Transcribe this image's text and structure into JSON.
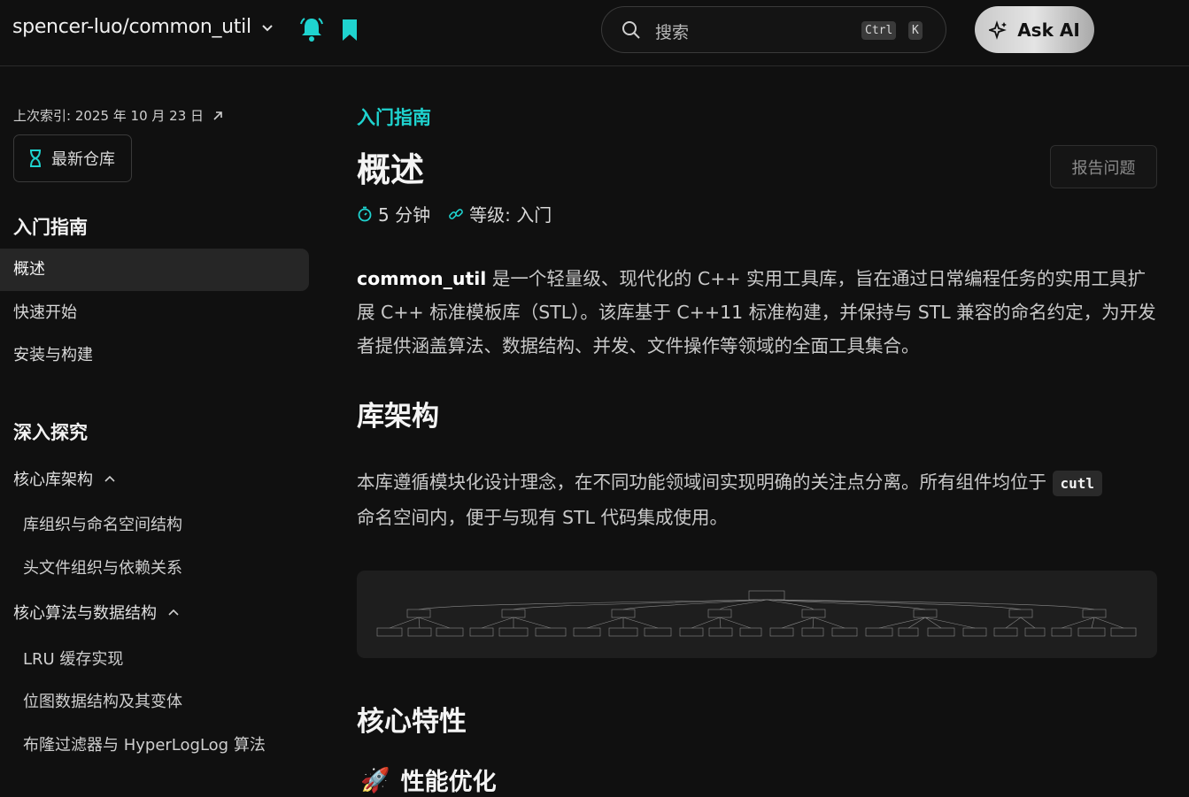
{
  "header": {
    "repo_name": "spencer-luo/common_util",
    "search_placeholder": "搜索",
    "kbd_ctrl": "Ctrl",
    "kbd_k": "K",
    "ask_ai": "Ask AI"
  },
  "sidebar": {
    "last_indexed": "上次索引: 2025 年 10 月 23 日",
    "latest_repo": "最新仓库",
    "section1_title": "入门指南",
    "section1_items": [
      "概述",
      "快速开始",
      "安装与构建"
    ],
    "section2_title": "深入探究",
    "group1": "核心库架构",
    "group1_items": [
      "库组织与命名空间结构",
      "头文件组织与依赖关系"
    ],
    "group2": "核心算法与数据结构",
    "group2_items": [
      "LRU 缓存实现",
      "位图数据结构及其变体",
      "布隆过滤器与 HyperLogLog 算法"
    ]
  },
  "main": {
    "breadcrumb": "入门指南",
    "title": "概述",
    "report_button": "报告问题",
    "read_time": "5 分钟",
    "level": "等级: 入门",
    "intro_bold": "common_util",
    "intro_rest": " 是一个轻量级、现代化的 C++ 实用工具库，旨在通过日常编程任务的实用工具扩展 C++ 标准模板库（STL）。该库基于 C++11 标准构建，并保持与 STL 兼容的命名约定，为开发者提供涵盖算法、数据结构、并发、文件操作等领域的全面工具集合。",
    "h2_arch": "库架构",
    "arch_text_before": "本库遵循模块化设计理念，在不同功能领域间实现明确的关注点分离。所有组件均位于",
    "arch_code": "cutl",
    "arch_text_after": "命名空间内，便于与现有 STL 代码集成使用。",
    "h2_features": "核心特性",
    "h3_perf": "性能优化",
    "rocket": "🚀"
  },
  "colors": {
    "accent": "#1fd3cf",
    "background": "#101010"
  }
}
